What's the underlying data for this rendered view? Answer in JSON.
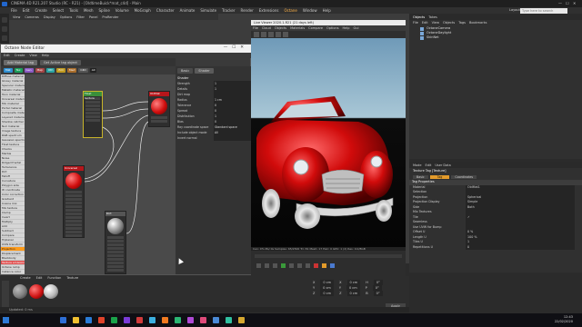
{
  "app": {
    "title": "CINEMA 4D R21.207 Studio (RC - R21) - [OldtimeBuick*mat_c4d] - Main",
    "menu": [
      "File",
      "Edit",
      "Create",
      "Select",
      "Tools",
      "Mesh",
      "Spline",
      "Volume",
      "MoGraph",
      "Character",
      "Animate",
      "Simulate",
      "Tracker",
      "Render",
      "Extensions",
      "Octane",
      "Window",
      "Help"
    ],
    "active_menu": "Octane",
    "layout_label": "Layout:",
    "layout_value": "Startup (User)"
  },
  "viewport": {
    "menu": [
      "View",
      "Cameras",
      "Display",
      "Options",
      "Filter",
      "Panel",
      "ProRender"
    ]
  },
  "node_editor": {
    "title": "Octane Node Editor",
    "menu": [
      "Edit",
      "Create",
      "View",
      "Help"
    ],
    "tabs": [
      "Add Material tag",
      "Get Active tag object"
    ],
    "chips": [
      {
        "label": "Mat",
        "color": "#2f8fd1"
      },
      {
        "label": "Tex",
        "color": "#1b9e5a"
      },
      {
        "label": "Gen",
        "color": "#8b5ac4"
      },
      {
        "label": "Map",
        "color": "#a64444"
      },
      {
        "label": "Oth",
        "color": "#2aa3a3"
      },
      {
        "label": "Emi",
        "color": "#c09a20"
      },
      {
        "label": "Med",
        "color": "#aa6d2a"
      },
      {
        "label": "C4D",
        "color": "#555555"
      },
      {
        "label": "All",
        "color": "#222222"
      }
    ],
    "list": [
      "Diffuse material",
      "Glossy material",
      "Specular material",
      "Metallic material",
      "Toon material",
      "Universal material",
      "Mix material",
      "Portal material",
      "Composite material",
      "Layered material",
      "Shadow catcher",
      "Null material",
      "Image texture",
      "RGB spectrum",
      "Gaussian spectrum",
      "Float texture",
      "Checks",
      "Marble",
      "Noise",
      "Ridged fractal",
      "Turbulence",
      "Dirt",
      "Falloff",
      "Curvature",
      "Polygon side",
      "W coordinate",
      "Color correction",
      "Gradient",
      "Cosine mix",
      "Mix texture",
      "Clamp",
      "Invert",
      "Multiply",
      "Add",
      "Subtract",
      "Compare",
      "Triplanar",
      "UVW transform",
      "Projection",
      "Displacement",
      "Blackbody",
      "Texture emission",
      "Octane ramp",
      "Instance color",
      "Random color"
    ],
    "list_selected": 38,
    "list_highlight": 41,
    "nodes": [
      {
        "label": "Float texture",
        "color": "#3a8f3a"
      },
      {
        "label": "OldMat",
        "color": "#b5161b"
      },
      {
        "label": "Universal",
        "color": "#b5161b"
      },
      {
        "label": "Dirt",
        "color": "#555555"
      }
    ],
    "attr_tabs": [
      "Basic",
      "Shader"
    ],
    "attr_section": "Shader",
    "attr_rows": [
      {
        "label": "Strength",
        "value": "1"
      },
      {
        "label": "Details",
        "value": "1"
      },
      {
        "label": "Dirt map",
        "value": ""
      },
      {
        "label": "Radius",
        "value": "1 cm"
      },
      {
        "label": "Tolerance",
        "value": "0"
      },
      {
        "label": "Spread",
        "value": "0"
      },
      {
        "label": "Distribution",
        "value": "1"
      },
      {
        "label": "Bias",
        "value": "0"
      },
      {
        "label": "Ray coordinate space",
        "value": "Standard space"
      },
      {
        "label": "Include object mode",
        "value": "All"
      },
      {
        "label": "Invert normal",
        "value": ""
      }
    ]
  },
  "live_viewer": {
    "title": "Live Viewer 2020.1.R21 (21 days left)",
    "menu": [
      "File",
      "Cloud",
      "Objects",
      "Materials",
      "Compare",
      "Options",
      "Help",
      "Gui"
    ],
    "status": "Cen: 0% Ms/ 0s  Samples: 65/2500  Tri: 81 Mesh: 17  Hair: 0  GPU: 1 (2)  Res: 0.0/8GB"
  },
  "object_manager": {
    "tabs": [
      "Objects",
      "Takes"
    ],
    "menu": [
      "File",
      "Edit",
      "View",
      "Objects",
      "Tags",
      "Bookmarks"
    ],
    "rows": [
      "OctaneCamera",
      "OctaneDaylight",
      "SkinNet"
    ]
  },
  "attribute_manager": {
    "menu": [
      "Mode",
      "Edit",
      "User Data"
    ],
    "title": "Texture Tag [Texture]",
    "tabs": [
      "Basic",
      "Tag",
      "Coordinates"
    ],
    "section": "Tag Properties",
    "rows": [
      {
        "label": "Material",
        "value": "OldMat1"
      },
      {
        "label": "Selection",
        "value": ""
      },
      {
        "label": "Projection",
        "value": "Spherical"
      },
      {
        "label": "Projection Display",
        "value": "Simple"
      },
      {
        "label": "Side",
        "value": "Both"
      },
      {
        "label": "Mix Textures",
        "value": ""
      },
      {
        "label": "Tile",
        "value": "✓"
      },
      {
        "label": "Seamless",
        "value": ""
      },
      {
        "label": "Use UVW for Bump",
        "value": ""
      },
      {
        "label": "Offset U",
        "value": "0 %"
      },
      {
        "label": "Length U",
        "value": "100 %"
      },
      {
        "label": "Tiles U",
        "value": "1"
      },
      {
        "label": "Repetitions U",
        "value": "0"
      }
    ]
  },
  "materials": {
    "menu": [
      "Create",
      "Edit",
      "Function",
      "Texture"
    ],
    "items": [
      {
        "color": "#7d7d7d"
      },
      {
        "color": "#d01414"
      },
      {
        "color": "#b8b8b8"
      }
    ]
  },
  "coords": {
    "rows": [
      [
        "X",
        "0 cm",
        "X",
        "0 cm",
        "H",
        "0°"
      ],
      [
        "Y",
        "0 cm",
        "Y",
        "0 cm",
        "P",
        "0°"
      ],
      [
        "Z",
        "0 cm",
        "Z",
        "0 cm",
        "B",
        "0°"
      ]
    ],
    "apply": "Apply"
  },
  "statusbar": "Updated: 0 ms",
  "taskbar": {
    "search_placeholder": "Type here to search",
    "time": "12:43",
    "date": "22/02/2020",
    "icons": [
      "#2e6fd6",
      "#f0c030",
      "#2a7cd8",
      "#e0432a",
      "#1aa34a",
      "#7a3bd8",
      "#d23b3b",
      "#3bb0e0",
      "#f07a20",
      "#2bb673",
      "#b04ad6",
      "#e04a7a",
      "#4a8ad6",
      "#30c0a0",
      "#d6a830"
    ]
  }
}
